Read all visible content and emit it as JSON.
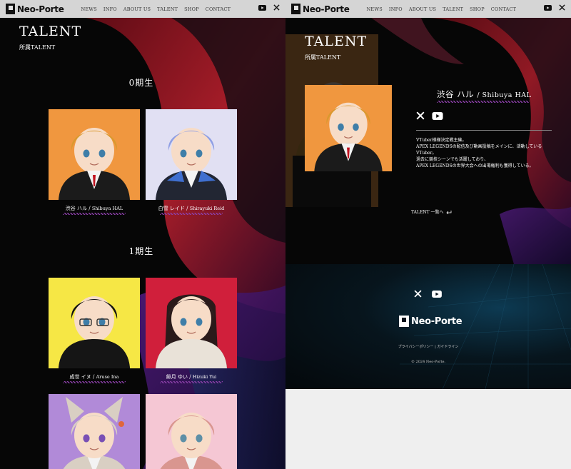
{
  "header": {
    "logo_text": "Neo-Porte",
    "nav": [
      "NEWS",
      "INFO",
      "ABOUT US",
      "TALENT",
      "SHOP",
      "CONTACT"
    ],
    "icons": [
      "youtube-icon",
      "x-icon"
    ]
  },
  "talent_list": {
    "title": "TALENT",
    "subtitle": "所属TALENT",
    "gen0": "0期生",
    "gen1": "1期生",
    "cards": [
      {
        "jp": "渋谷 ハル",
        "en": "Shibuya HAL",
        "bg": "#f0973f"
      },
      {
        "jp": "白雪 レイド",
        "en": "Shirayuki Reid",
        "bg": "#e1e0f3"
      },
      {
        "jp": "成世 イヌ",
        "en": "Aruse Ina",
        "bg": "#f6e745"
      },
      {
        "jp": "緋月 ゆい",
        "en": "Hizuki Yui",
        "bg": "#d01f3b"
      },
      {
        "bg": "#b18ad8"
      },
      {
        "bg": "#f5c7d4"
      }
    ]
  },
  "talent_detail": {
    "title": "TALENT",
    "subtitle": "所属TALENT",
    "name_jp": "渋谷 ハル",
    "name_en": "/ Shibuya HAL",
    "bio": [
      "VTuber様様決定戦主催。",
      "APEX LEGENDSの配信及び動画投稿をメインに、活動している",
      "VTuber。",
      "過去に競技シーンでも活躍しており、",
      "APEX LEGENDSの世界大会への出場権利も獲得している。"
    ],
    "back_link": "TALENT 一覧へ"
  },
  "footer": {
    "logo_text": "Neo-Porte",
    "links": [
      "プライバシーポリシー",
      "ガイドライン"
    ],
    "link_separator": "|",
    "copyright": "© 2024 Neo-Porte."
  },
  "colors": {
    "accent_purple": "#8b3fa8",
    "header_bg": "#e2e2e2",
    "page_bg": "#060606"
  }
}
